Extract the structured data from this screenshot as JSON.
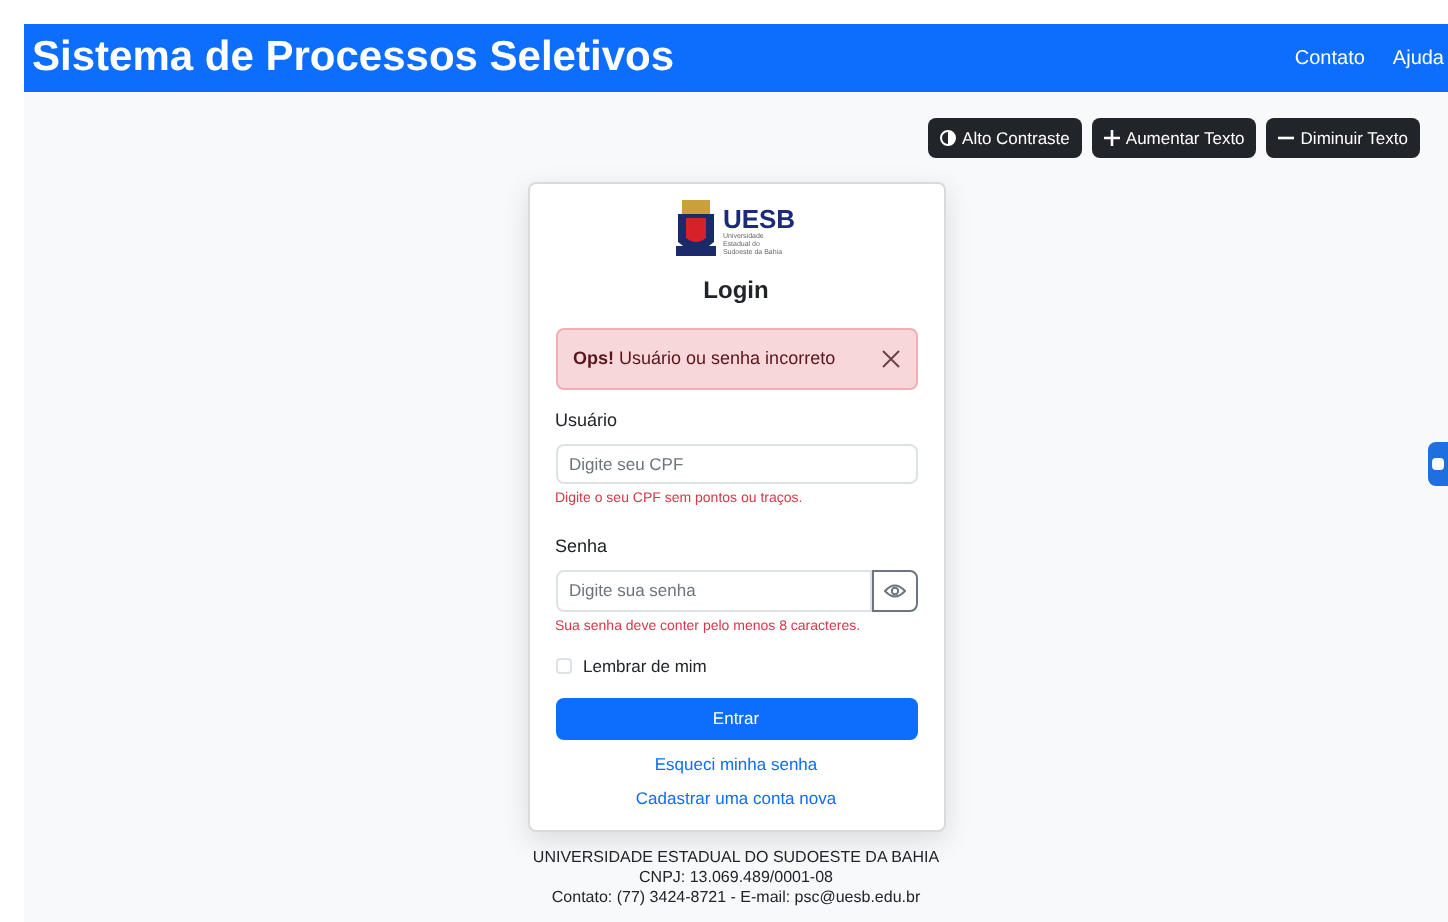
{
  "header": {
    "title": "Sistema de Processos Seletivos",
    "nav": [
      "Contato",
      "Ajuda"
    ]
  },
  "accessibility_buttons": [
    {
      "kind": "contrast",
      "label": "Alto Contraste"
    },
    {
      "kind": "plus",
      "label": "Aumentar Texto"
    },
    {
      "kind": "minus",
      "label": "Diminuir Texto"
    }
  ],
  "login_card": {
    "logo": {
      "name": "UESB",
      "subtitle": "Universidade Estadual do Sudoeste da Bahia"
    },
    "title": "Login",
    "alert": {
      "text": "**Ops!** Usuário ou senha incorreto"
    },
    "user_field": {
      "label": "Usuário",
      "placeholder": "Digite seu CPF",
      "error": "Digite o seu CPF sem pontos ou traços."
    },
    "password_field": {
      "label": "Senha",
      "placeholder": "Digite sua senha",
      "error": "Sua senha deve conter pelo menos 8 caracteres."
    },
    "remember": {
      "label": "Lembrar de mim",
      "checked": false
    },
    "submit": "Entrar",
    "links": [
      "Esqueci minha senha",
      "Cadastrar uma conta nova"
    ]
  },
  "footer": [
    "UNIVERSIDADE ESTADUAL DO SUDOESTE DA BAHIA",
    "CNPJ: 13.069.489/0001-08",
    "Contato: (77) 3424-8721 - E-mail: psc@uesb.edu.br"
  ]
}
